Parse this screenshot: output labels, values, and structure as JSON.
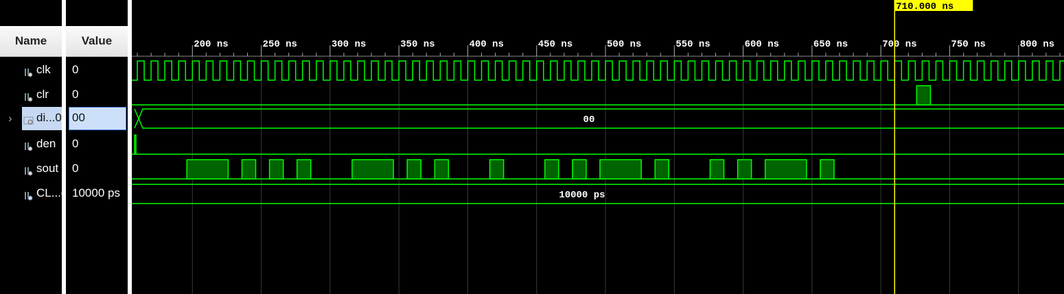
{
  "columns": {
    "name": "Name",
    "value": "Value"
  },
  "cursor": {
    "label": "710.000 ns",
    "time_ns": 710,
    "color": "#ffff00"
  },
  "timeline": {
    "unit": "ns",
    "ticks": [
      {
        "t": 200,
        "label": "200 ns"
      },
      {
        "t": 250,
        "label": "250 ns"
      },
      {
        "t": 300,
        "label": "300 ns"
      },
      {
        "t": 350,
        "label": "350 ns"
      },
      {
        "t": 400,
        "label": "400 ns"
      },
      {
        "t": 450,
        "label": "450 ns"
      },
      {
        "t": 500,
        "label": "500 ns"
      },
      {
        "t": 550,
        "label": "550 ns"
      },
      {
        "t": 600,
        "label": "600 ns"
      },
      {
        "t": 650,
        "label": "650 ns"
      },
      {
        "t": 700,
        "label": "700 ns"
      },
      {
        "t": 750,
        "label": "750 ns"
      },
      {
        "t": 800,
        "label": "800 ns"
      }
    ],
    "view_start_ns": 156,
    "view_end_ns": 833
  },
  "signals": [
    {
      "key": "clk",
      "name": "clk",
      "value": "0",
      "type": "bit",
      "icon": "bit-signal-icon",
      "selected": false
    },
    {
      "key": "clr",
      "name": "clr",
      "value": "0",
      "type": "bit",
      "icon": "bit-signal-icon",
      "selected": false
    },
    {
      "key": "din",
      "name": "di...0",
      "value": "00",
      "type": "bus",
      "icon": "bus-signal-icon",
      "selected": true,
      "expandable": true
    },
    {
      "key": "den",
      "name": "den",
      "value": "0",
      "type": "bit",
      "icon": "bit-signal-icon",
      "selected": false
    },
    {
      "key": "sout",
      "name": "sout",
      "value": "0",
      "type": "bit",
      "icon": "bit-signal-icon",
      "selected": false
    },
    {
      "key": "clkp",
      "name": "CL...d",
      "value": "10000 ps",
      "type": "const",
      "icon": "parameter-icon",
      "selected": false
    }
  ],
  "waves": {
    "clk_period_ns": 10,
    "clr_high": [
      [
        726,
        736
      ]
    ],
    "din_value": "00",
    "den_high": [
      [
        158,
        159
      ]
    ],
    "sout_high": [
      [
        196,
        226
      ],
      [
        236,
        246
      ],
      [
        256,
        266
      ],
      [
        276,
        286
      ],
      [
        316,
        346
      ],
      [
        356,
        366
      ],
      [
        376,
        386
      ],
      [
        416,
        426
      ],
      [
        456,
        466
      ],
      [
        476,
        486
      ],
      [
        496,
        526
      ],
      [
        536,
        546
      ],
      [
        576,
        586
      ],
      [
        596,
        606
      ],
      [
        616,
        646
      ],
      [
        656,
        666
      ]
    ],
    "const_value": "10000 ps"
  },
  "colors": {
    "wave": "#00ff00",
    "wave_fill": "#006400",
    "grid": "#3a3a3a",
    "background": "#000000"
  }
}
